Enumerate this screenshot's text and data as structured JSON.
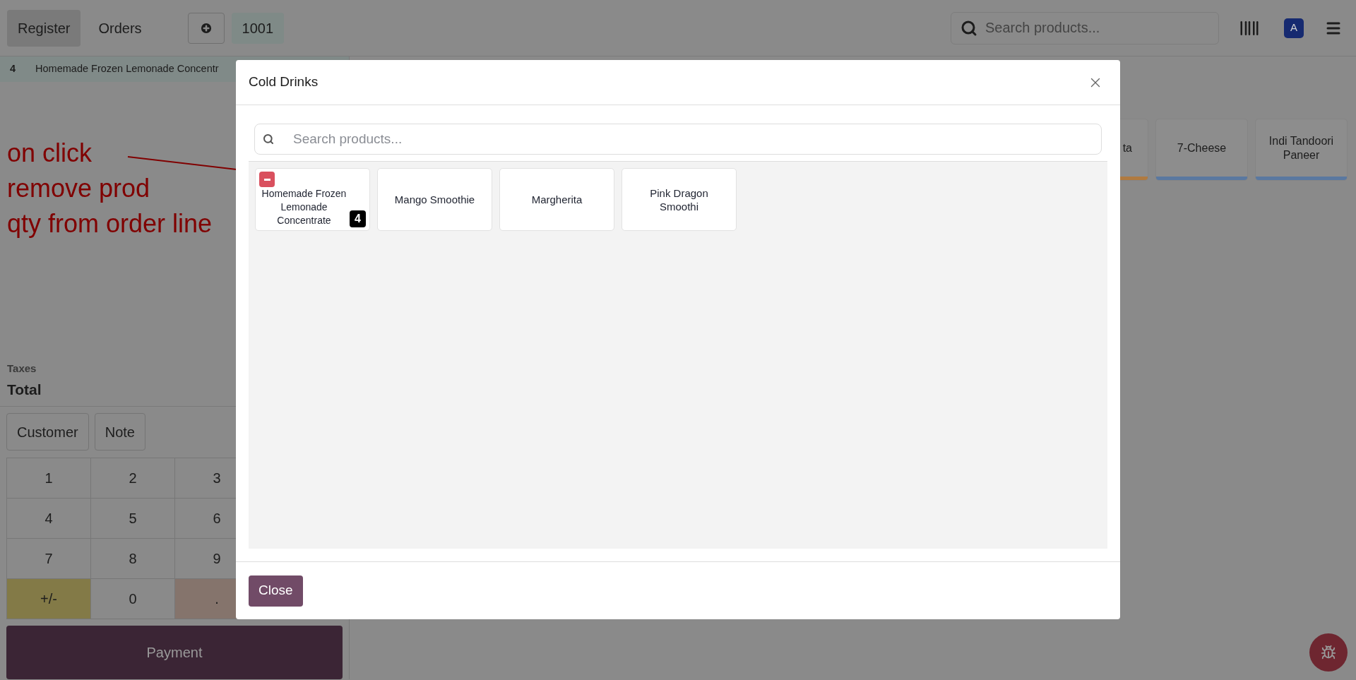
{
  "topbar": {
    "tabs": [
      {
        "label": "Register",
        "selected": true
      },
      {
        "label": "Orders",
        "selected": false
      }
    ],
    "order_number": "1001",
    "search": {
      "placeholder": "Search products..."
    },
    "user_initial": "A"
  },
  "order_lines": [
    {
      "qty": "4",
      "name": "Homemade Frozen Lemonade Concentr"
    }
  ],
  "summary": {
    "taxes_label": "Taxes",
    "total_label": "Total"
  },
  "actions": [
    "Customer",
    "Note"
  ],
  "numpad": [
    {
      "label": "1",
      "kind": "digit"
    },
    {
      "label": "2",
      "kind": "digit"
    },
    {
      "label": "3",
      "kind": "digit"
    },
    {
      "label": "4",
      "kind": "digit"
    },
    {
      "label": "5",
      "kind": "digit"
    },
    {
      "label": "6",
      "kind": "digit"
    },
    {
      "label": "7",
      "kind": "digit"
    },
    {
      "label": "8",
      "kind": "digit"
    },
    {
      "label": "9",
      "kind": "digit"
    },
    {
      "label": "+/-",
      "kind": "sign"
    },
    {
      "label": "0",
      "kind": "digit"
    },
    {
      "label": ".",
      "kind": "decimal"
    }
  ],
  "payment_button": "Payment",
  "product_tiles": [
    {
      "name": "ta",
      "color": "#b07a40"
    },
    {
      "name": "7-Cheese",
      "color": "#5a78a0"
    },
    {
      "name": "Indi Tandoori Paneer",
      "color": "#5a78a0"
    }
  ],
  "annotation": {
    "lines": [
      "on click",
      "remove prod",
      "qty from order line"
    ]
  },
  "dialog": {
    "title": "Cold Drinks",
    "search": {
      "placeholder": "Search products..."
    },
    "products": [
      {
        "name": "Homemade Frozen Lemonade Concentrate",
        "qty": "4",
        "removable": true
      },
      {
        "name": "Mango Smoothie",
        "removable": false
      },
      {
        "name": "Margherita",
        "removable": false
      },
      {
        "name": "Pink Dragon Smoothi",
        "removable": false
      }
    ],
    "close_button": "Close"
  }
}
